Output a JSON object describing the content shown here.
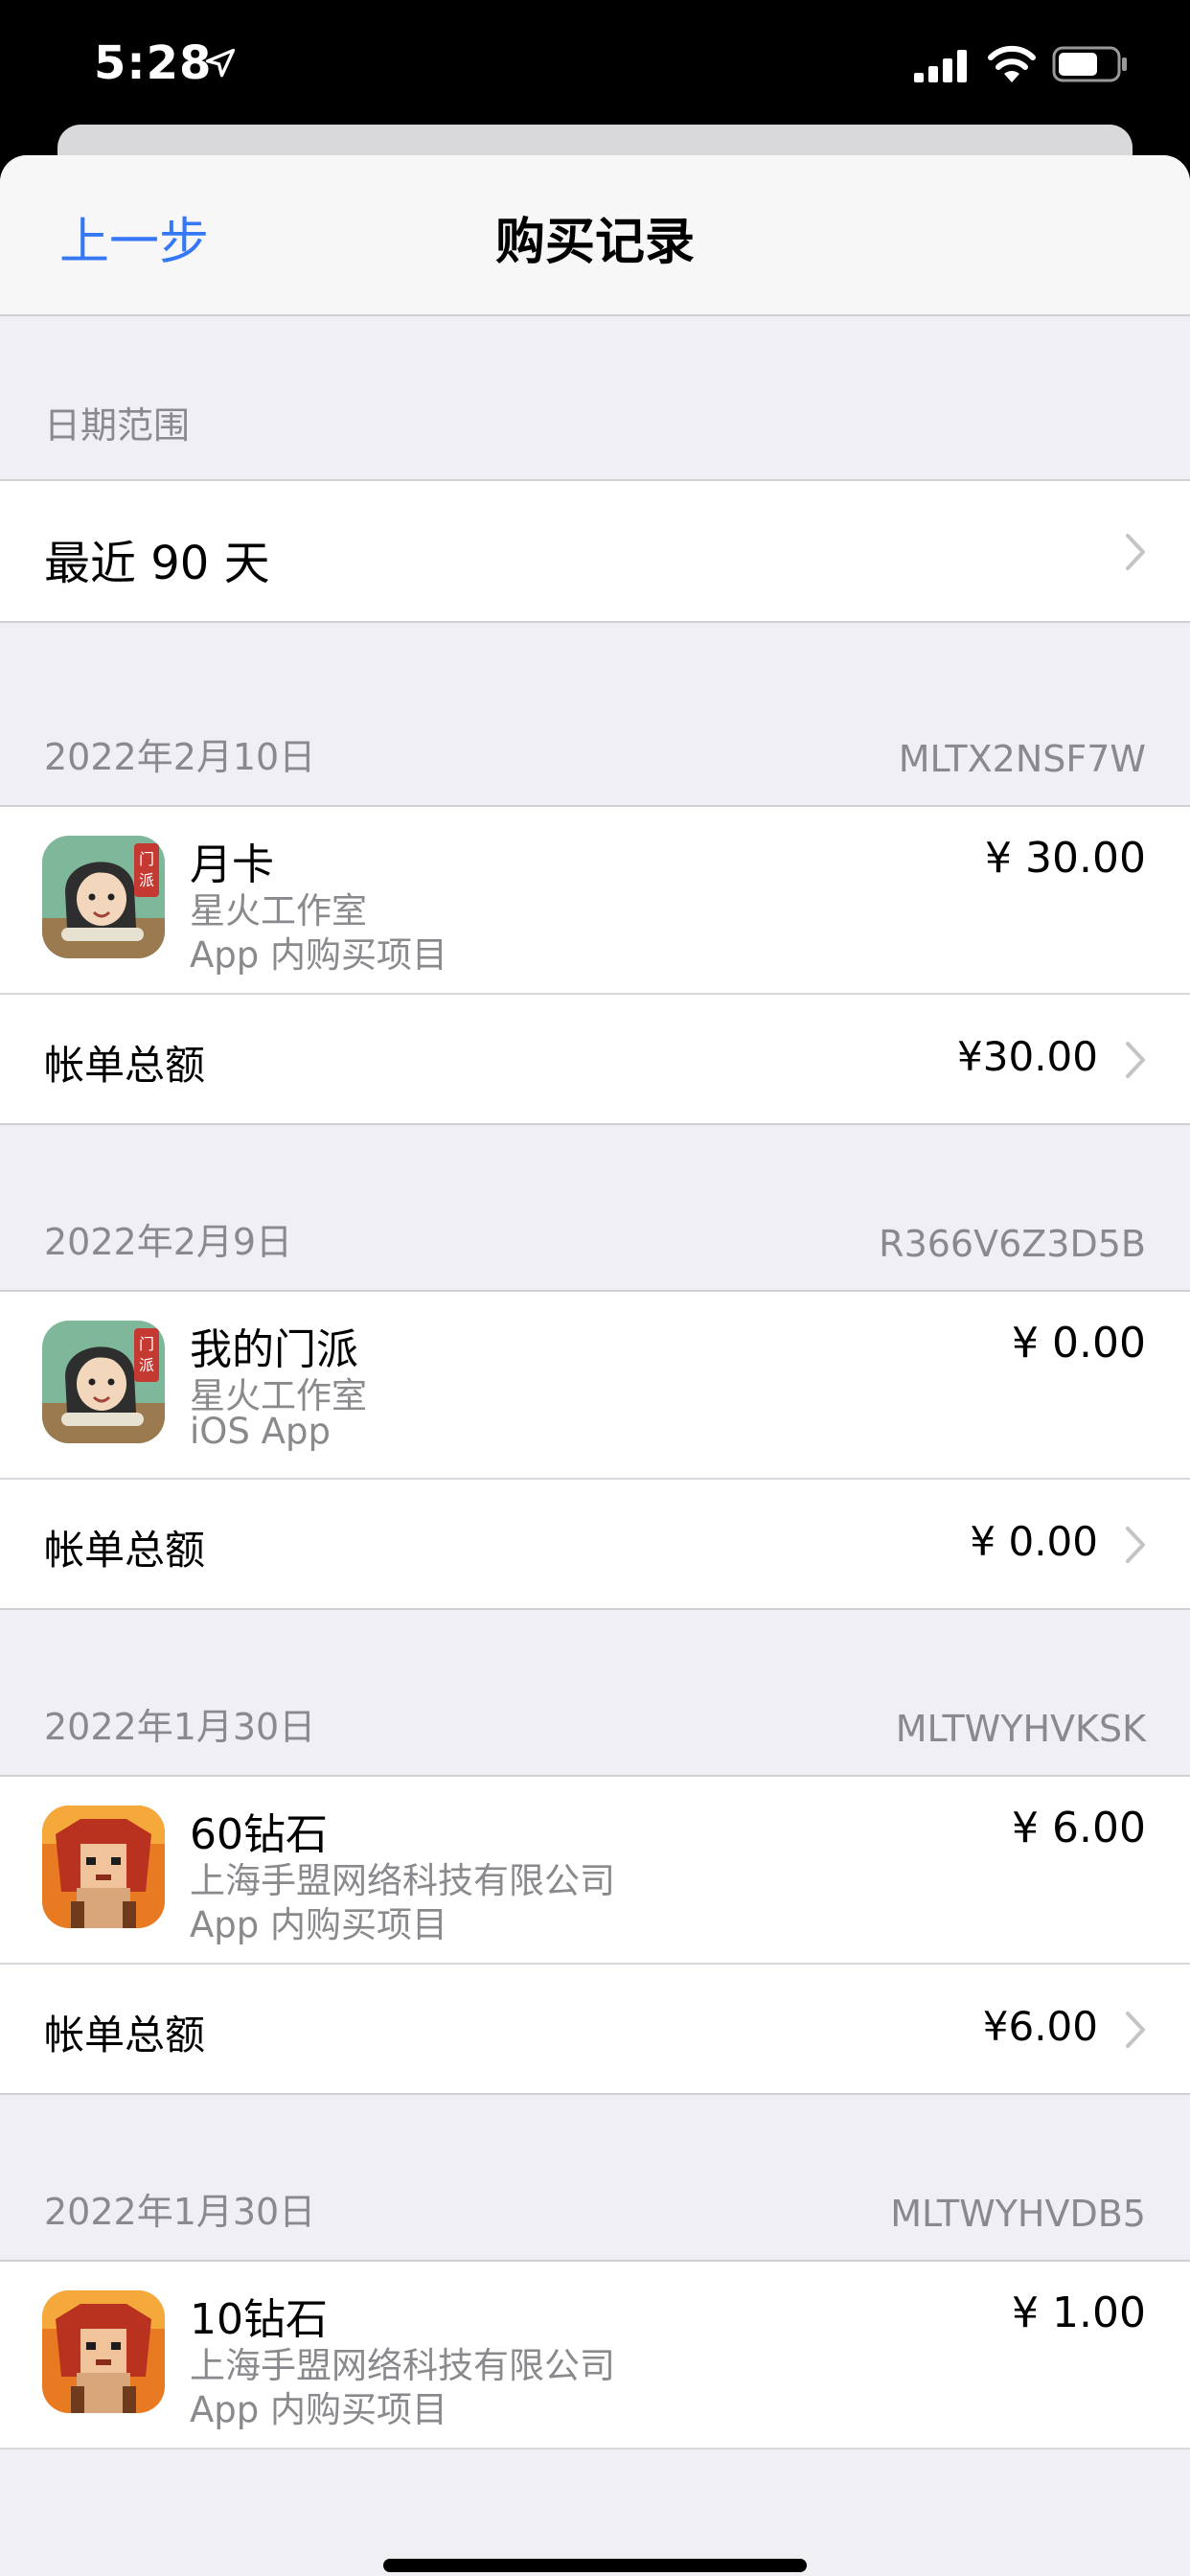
{
  "status_bar": {
    "time": "5:28"
  },
  "nav": {
    "back_label": "上一步",
    "title": "购买记录"
  },
  "date_range": {
    "header": "日期范围",
    "value": "最近 90 天"
  },
  "orders": [
    {
      "date": "2022年2月10日",
      "order_id": "MLTX2NSF7W",
      "item": {
        "title": "月卡",
        "developer": "星火工作室",
        "type": "App 内购买项目",
        "price": "¥ 30.00",
        "icon": "sect-game-icon"
      },
      "total_label": "帐单总额",
      "total": "¥30.00"
    },
    {
      "date": "2022年2月9日",
      "order_id": "R366V6Z3D5B",
      "item": {
        "title": "我的门派",
        "developer": "星火工作室",
        "type": "iOS App",
        "price": "¥ 0.00",
        "icon": "sect-game-icon"
      },
      "total_label": "帐单总额",
      "total": "¥ 0.00"
    },
    {
      "date": "2022年1月30日",
      "order_id": "MLTWYHVKSK",
      "item": {
        "title": "60钻石",
        "developer": "上海手盟网络科技有限公司",
        "type": "App 内购买项目",
        "price": "¥ 6.00",
        "icon": "pixel-warrior-game-icon"
      },
      "total_label": "帐单总额",
      "total": "¥6.00"
    },
    {
      "date": "2022年1月30日",
      "order_id": "MLTWYHVDB5",
      "item": {
        "title": "10钻石",
        "developer": "上海手盟网络科技有限公司",
        "type": "App 内购买项目",
        "price": "¥ 1.00",
        "icon": "pixel-warrior-game-icon"
      }
    }
  ],
  "colors": {
    "accent": "#3478f6",
    "secondary_text": "#8a8a8e",
    "grouped_background": "#efeff4"
  }
}
